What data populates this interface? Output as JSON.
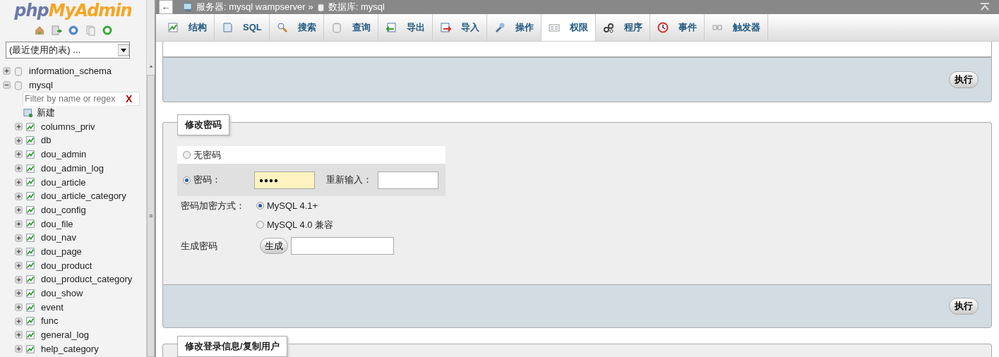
{
  "sidebar": {
    "logo_parts": [
      "php",
      "MyAdmin"
    ],
    "recent_tables": "(最近使用的表) ...",
    "databases": [
      {
        "name": "information_schema",
        "expanded": false
      },
      {
        "name": "mysql",
        "expanded": true,
        "filter_placeholder": "Filter by name or regex",
        "filter_clear": "X",
        "new_item": "新建",
        "children": [
          {
            "name": "columns_priv"
          },
          {
            "name": "db"
          },
          {
            "name": "dou_admin"
          },
          {
            "name": "dou_admin_log"
          },
          {
            "name": "dou_article"
          },
          {
            "name": "dou_article_category"
          },
          {
            "name": "dou_config"
          },
          {
            "name": "dou_file"
          },
          {
            "name": "dou_nav"
          },
          {
            "name": "dou_page"
          },
          {
            "name": "dou_product"
          },
          {
            "name": "dou_product_category"
          },
          {
            "name": "dou_show"
          },
          {
            "name": "event"
          },
          {
            "name": "func"
          },
          {
            "name": "general_log"
          },
          {
            "name": "help_category"
          }
        ]
      }
    ]
  },
  "breadcrumb": {
    "back": "←",
    "server": "服务器: mysql wampserver",
    "separator": "»",
    "database": "数据库: mysql"
  },
  "tabs": [
    {
      "label": "结构",
      "selected": false
    },
    {
      "label": "SQL",
      "selected": false
    },
    {
      "label": "搜索",
      "selected": false
    },
    {
      "label": "查询",
      "selected": false
    },
    {
      "label": "导出",
      "selected": false
    },
    {
      "label": "导入",
      "selected": false
    },
    {
      "label": "操作",
      "selected": false
    },
    {
      "label": "权限",
      "selected": true
    },
    {
      "label": "程序",
      "selected": false
    },
    {
      "label": "事件",
      "selected": false
    },
    {
      "label": "触发器",
      "selected": false
    }
  ],
  "top_panel": {
    "submit": "执行"
  },
  "password_form": {
    "legend": "修改密码",
    "modes": [
      {
        "label": "无密码",
        "selected": false
      },
      {
        "label": "密码：",
        "selected": true,
        "value": "●●●●",
        "reenter_label": "重新输入："
      }
    ],
    "hashing_label": "密码加密方式：",
    "hashing_options": [
      {
        "label": "MySQL 4.1+",
        "selected": true
      },
      {
        "label": "MySQL 4.0 兼容",
        "selected": false
      }
    ],
    "generate_label": "生成密码",
    "generate_button": "生成",
    "submit": "执行"
  },
  "next_section": {
    "legend": "修改登录信息/复制用户"
  }
}
